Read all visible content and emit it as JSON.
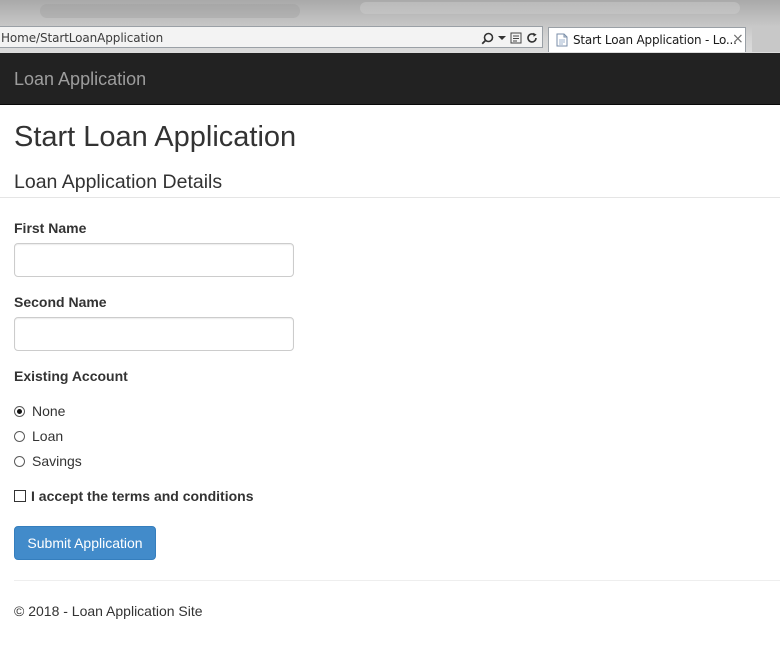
{
  "browser": {
    "address": "Home/StartLoanApplication",
    "tab_title": "Start Loan Application - Lo...",
    "tab_close": "×",
    "icons": [
      "search-icon",
      "dropdown-arrow-icon",
      "compat-view-icon",
      "refresh-icon",
      "page-icon",
      "close-icon"
    ]
  },
  "navbar": {
    "brand": "Loan Application"
  },
  "page": {
    "title": "Start Loan Application",
    "section_title": "Loan Application Details"
  },
  "form": {
    "first_name_label": "First Name",
    "first_name_value": "",
    "second_name_label": "Second Name",
    "second_name_value": "",
    "existing_account_label": "Existing Account",
    "existing_account_options": [
      "None",
      "Loan",
      "Savings"
    ],
    "existing_account_selected": "None",
    "terms_label": "I accept the terms and conditions",
    "terms_checked": false,
    "submit_label": "Submit Application"
  },
  "footer": {
    "text": "© 2018 - Loan Application Site"
  },
  "colors": {
    "navbar_bg": "#222222",
    "brand_text": "#9d9d9d",
    "primary_button": "#428bca"
  }
}
